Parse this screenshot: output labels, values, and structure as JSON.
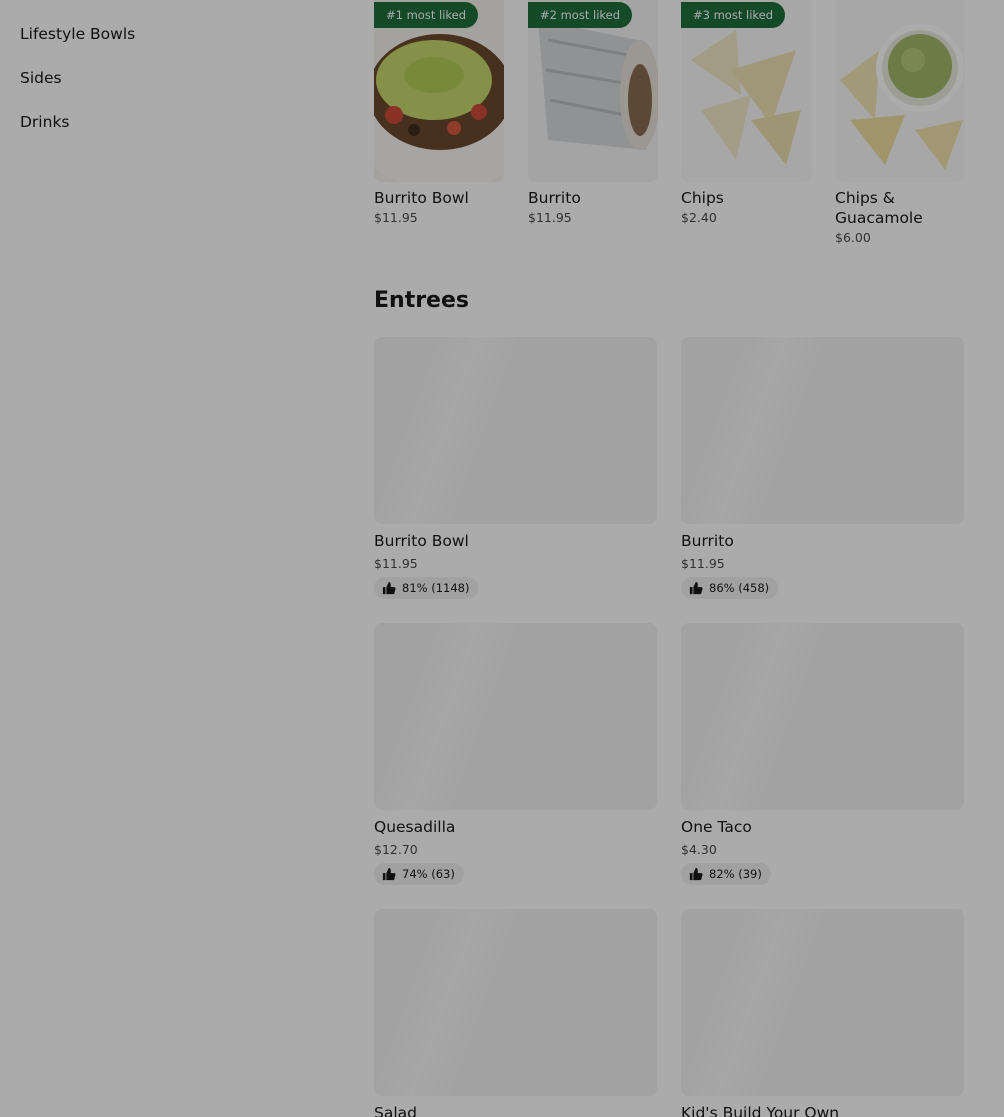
{
  "sidebar": {
    "items": [
      {
        "label": "Lifestyle Bowls"
      },
      {
        "label": "Sides"
      },
      {
        "label": "Drinks"
      }
    ]
  },
  "most_liked": [
    {
      "badge": "#1 most liked",
      "name": "Burrito Bowl",
      "price": "$11.95"
    },
    {
      "badge": "#2 most liked",
      "name": "Burrito",
      "price": "$11.95"
    },
    {
      "badge": "#3 most liked",
      "name": "Chips",
      "price": "$2.40"
    },
    {
      "badge": "",
      "name": "Chips & Guacamole",
      "price": "$6.00"
    }
  ],
  "entrees": {
    "title": "Entrees",
    "items": [
      {
        "name": "Burrito Bowl",
        "price": "$11.95",
        "rating": "81% (1148)"
      },
      {
        "name": "Burrito",
        "price": "$11.95",
        "rating": "86% (458)"
      },
      {
        "name": "Quesadilla",
        "price": "$12.70",
        "rating": "74% (63)"
      },
      {
        "name": "One Taco",
        "price": "$4.30",
        "rating": "82% (39)"
      },
      {
        "name": "Salad",
        "price": "",
        "rating": ""
      },
      {
        "name": "Kid's Build Your Own",
        "price": "",
        "rating": ""
      }
    ]
  },
  "colors": {
    "badge_green": "#1f6f3d",
    "overlay": "rgba(0,0,0,0.33)",
    "text": "#191919"
  },
  "icons": [
    "thumbs-up-icon"
  ]
}
